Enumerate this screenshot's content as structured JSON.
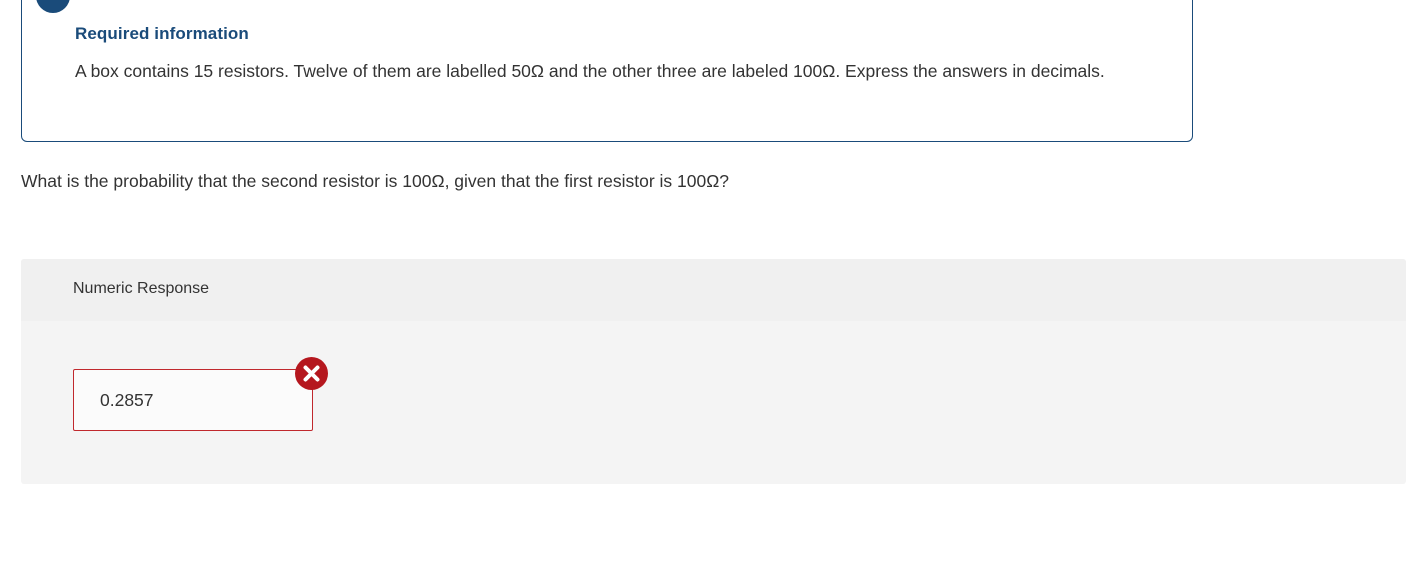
{
  "info": {
    "badge": "!",
    "title": "Required information",
    "text": "A box contains 15 resistors. Twelve of them are labelled 50Ω and the other three are labeled 100Ω. Express the answers in decimals."
  },
  "question": {
    "text": "What is the probability that the second resistor is 100Ω, given that the first resistor is 100Ω?"
  },
  "response": {
    "type_label": "Numeric Response",
    "answer_value": "0.2857",
    "status": "incorrect"
  },
  "colors": {
    "accent": "#1a4b7a",
    "error": "#c0282d",
    "panel_bg": "#f4f4f4",
    "panel_header_bg": "#f0f0f0"
  },
  "icons": {
    "info_badge": "exclamation-icon",
    "status": "incorrect-x-icon"
  }
}
